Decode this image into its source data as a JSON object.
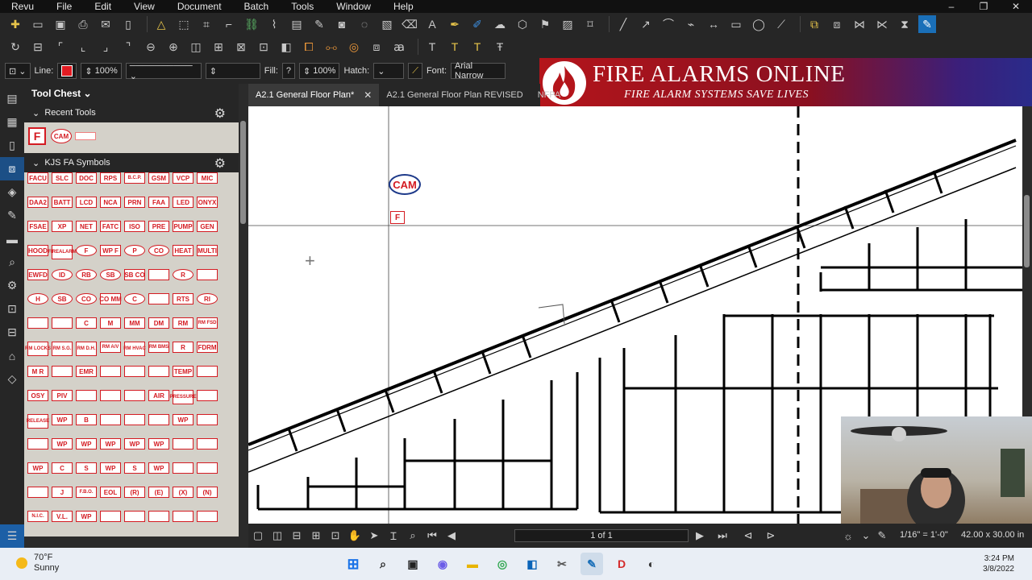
{
  "menu": [
    "Revu",
    "File",
    "Edit",
    "View",
    "Document",
    "Batch",
    "Tools",
    "Window",
    "Help"
  ],
  "window_controls": {
    "minimize": "–",
    "restore": "❐",
    "close": "✕"
  },
  "properties": {
    "line_label": "Line:",
    "line_opacity": "100%",
    "fill_label": "Fill:",
    "fill_value": "?",
    "fill_opacity": "100%",
    "hatch_label": "Hatch:",
    "font_label": "Font:",
    "font_value": "Arial Narrow",
    "line_color": "#e21b22"
  },
  "banner": {
    "title": "FIRE ALARMS ONLINE",
    "subtitle": "FIRE ALARM SYSTEMS SAVE LIVES"
  },
  "panel": {
    "title": "Tool Chest",
    "recent_title": "Recent Tools",
    "recent_items": [
      "F",
      "CAM",
      ""
    ],
    "section_title": "KJS FA Symbols",
    "rows": [
      [
        "FACU",
        "SLC",
        "DOC",
        "RPS",
        "B.C.P.",
        "GSM",
        "VCP",
        "MIC"
      ],
      [
        "DAA2",
        "BATT",
        "LCD",
        "NCA",
        "PRN",
        "FAA",
        "LED",
        "ONYX"
      ],
      [
        "FSAE",
        "XP",
        "NET",
        "FATC",
        "ISO",
        "PRE",
        "PUMP",
        "GEN"
      ],
      [
        "HOOD",
        "FIREALARM",
        "F",
        "WP F",
        "P",
        "CO",
        "HEAT",
        "MULTI"
      ],
      [
        "EWFD",
        "ID",
        "RB",
        "SB",
        "SB CO",
        "",
        "R",
        ""
      ],
      [
        "H",
        "SB",
        "CO",
        "CO MM",
        "C",
        "",
        "RTS",
        "RI"
      ],
      [
        "",
        "",
        "C",
        "M",
        "MM",
        "DM",
        "RM",
        "RM FSD"
      ],
      [
        "RM LOCKS",
        "RM S.G.",
        "RM D.H.",
        "RM A/V",
        "RM HVAC",
        "RM BMS",
        "R",
        "FDRM"
      ],
      [
        "M R",
        "",
        "EMR",
        "",
        "",
        "",
        "TEMP",
        ""
      ],
      [
        "OSY",
        "PIV",
        "",
        "",
        "",
        "AIR",
        "PRESSURE",
        ""
      ],
      [
        "RELEASE",
        "WP",
        "B",
        "",
        "",
        "",
        "WP",
        ""
      ],
      [
        "",
        "WP",
        "WP",
        "WP",
        "WP",
        "WP",
        "",
        ""
      ],
      [
        "WP",
        "C",
        "S",
        "WP",
        "S",
        "WP",
        "",
        ""
      ],
      [
        "",
        "J",
        "F.B.O.",
        "EOL",
        "(R)",
        "(E)",
        "(X)",
        "(N)"
      ],
      [
        "N.I.C.",
        "V.L.",
        "WP",
        "",
        "",
        "",
        "",
        ""
      ]
    ]
  },
  "tabs": [
    {
      "label": "A2.1 General Floor Plan*",
      "active": true
    },
    {
      "label": "A2.1 General Floor Plan REVISED",
      "active": false
    },
    {
      "label": "NFPA",
      "active": false
    }
  ],
  "canvas": {
    "cam_label": "CAM",
    "f_label": "F"
  },
  "status": {
    "page": "1 of 1",
    "scale": "1/16\" = 1'-0\"",
    "size": "42.00 x 30.00 in"
  },
  "taskbar": {
    "temp": "70°F",
    "condition": "Sunny",
    "time": "3:24 PM",
    "date": "3/8/2022"
  }
}
